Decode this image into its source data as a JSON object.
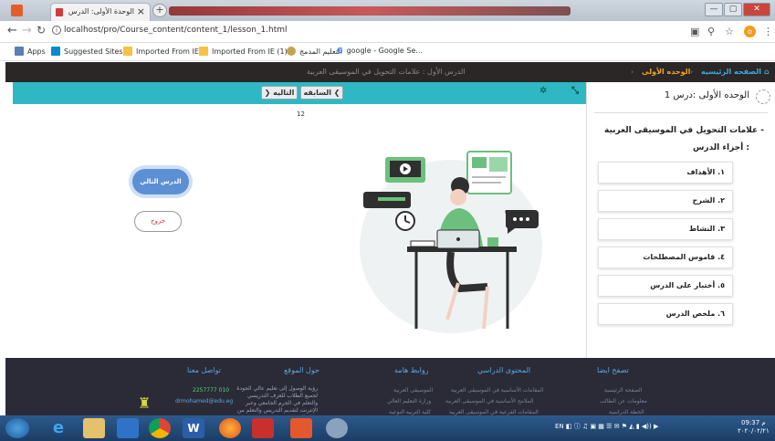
{
  "browser": {
    "tab_title": "الوحدة الأولى: الدرس الأول",
    "tab_close": "×",
    "new_tab": "+",
    "url": "localhost/pro/Course_content/content_1/lesson_1.html",
    "profile_initial": "o",
    "window_buttons": [
      "—",
      "▢",
      "✕"
    ]
  },
  "bookmarks": [
    {
      "label": "Apps",
      "icon": "apps-grid-icon",
      "color": "#5a7fb5"
    },
    {
      "label": "Suggested Sites",
      "icon": "bing-icon",
      "color": "#0b8ad1"
    },
    {
      "label": "Imported From IE",
      "icon": "folder-icon",
      "color": "#f5c242"
    },
    {
      "label": "Imported From IE (1)",
      "icon": "folder-icon",
      "color": "#f5c242"
    },
    {
      "label": "التعليم المدمج",
      "icon": "site-icon",
      "color": "#c8a24a"
    },
    {
      "label": "google - Google Se...",
      "icon": "google-icon",
      "color": "#4285f4"
    }
  ],
  "site_nav": {
    "home": "الصفحه الرئيسيه",
    "unit": "الوحده الأولى",
    "lesson": "الدرس الأول : علامات التحويل في الموسيقى العربية",
    "sep": "›"
  },
  "lesson_toolbar": {
    "prev": "السابقه ❮",
    "next": "❯ التاليه",
    "expand_icon": "⤡",
    "settings_icon": "✲"
  },
  "page_number": "12",
  "content": {
    "next_lesson": "الدرس التالي",
    "exit": "خروج"
  },
  "sidebar": {
    "title": "الوحده الأولى :درس 1",
    "subject": "- علامات التحويل في الموسيقى العربية",
    "parts_heading": "أجزاء الدرس :",
    "parts": [
      "١. الأهداف",
      "٢. الشرح",
      "٣. النشاط",
      "٤. قاموس المصطلحات",
      "٥. أختبار على الدرس",
      "٦. ملخص الدرس"
    ]
  },
  "footer": {
    "headings": [
      "تصفح ايضا",
      "المحتوى الدراسي",
      "روابط هامه",
      "حول الموقع",
      "تواصل معنا"
    ],
    "browse_links": [
      "الصفحة الرئيسية",
      "معلومات عن الطالب",
      "الخطة الدراسية"
    ],
    "content_links": [
      "المقامات الأساسية في الموسيقى العربية",
      "الملامح الأساسية في الموسيقى العربية",
      "المقامات الفرعية في الموسيقى العربية"
    ],
    "important_links": [
      "الموسيقى العربية",
      "وزارة التعليم العالي",
      "كلية التربية النوعية"
    ],
    "about_text": "رؤية الوصول إلى تعليم عالي الجودة لجميع الطلاب للعزف التدريسي والتعلم في الجرم الجامعي وعبر الإنترنت لتقديم التدريس والتعلم من خلال البيئة",
    "contact_phone": "010 2257777",
    "contact_email": "drmohamed@edu.eg"
  },
  "taskbar": {
    "lang": "EN",
    "time": "09:37 م",
    "date": "٢٠٢٠/٠٢/٢١"
  }
}
